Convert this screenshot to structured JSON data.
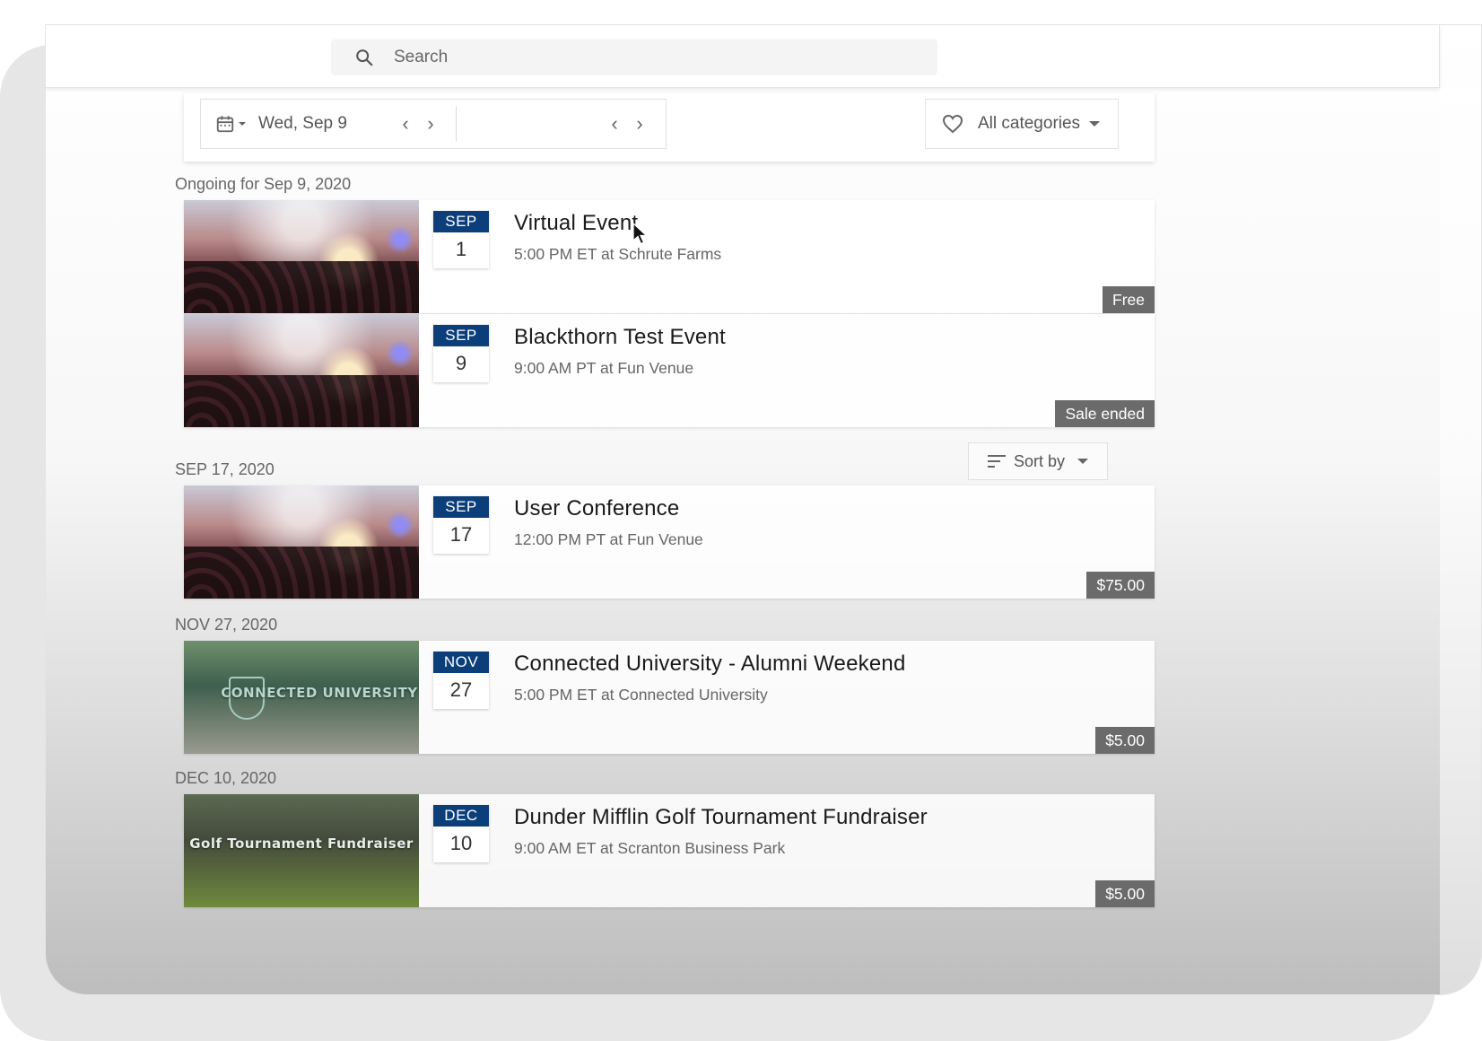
{
  "search": {
    "placeholder": "Search"
  },
  "filters": {
    "date_label": "Wed, Sep 9",
    "category_label": "All categories"
  },
  "sort": {
    "label": "Sort by"
  },
  "groups": [
    {
      "label": "Ongoing for Sep 9, 2020"
    },
    {
      "label": "SEP 17, 2020"
    },
    {
      "label": "NOV 27, 2020"
    },
    {
      "label": "DEC 10, 2020"
    }
  ],
  "events": [
    {
      "month": "SEP",
      "day": "1",
      "title": "Virtual Event",
      "subtitle": "5:00 PM ET at Schrute Farms",
      "price": "Free"
    },
    {
      "month": "SEP",
      "day": "9",
      "title": "Blackthorn Test Event",
      "subtitle": "9:00 AM PT at Fun Venue",
      "price": "Sale ended"
    },
    {
      "month": "SEP",
      "day": "17",
      "title": "User Conference",
      "subtitle": "12:00 PM PT at Fun Venue",
      "price": "$75.00"
    },
    {
      "month": "NOV",
      "day": "27",
      "title": "Connected University - Alumni Weekend",
      "subtitle": "5:00 PM ET at Connected University",
      "price": "$5.00",
      "thumb_text": "CONNECTED UNIVERSITY"
    },
    {
      "month": "DEC",
      "day": "10",
      "title": "Dunder Mifflin Golf Tournament Fundraiser",
      "subtitle": "9:00 AM ET at Scranton Business Park",
      "price": "$5.00",
      "thumb_text": "Golf Tournament Fundraiser"
    }
  ],
  "icons": {
    "search": "search-icon",
    "calendar": "calendar-icon",
    "heart": "heart-icon",
    "sort": "sort-icon"
  },
  "colors": {
    "month_badge": "#0c3f7a",
    "price_badge": "#6b6b6b"
  }
}
